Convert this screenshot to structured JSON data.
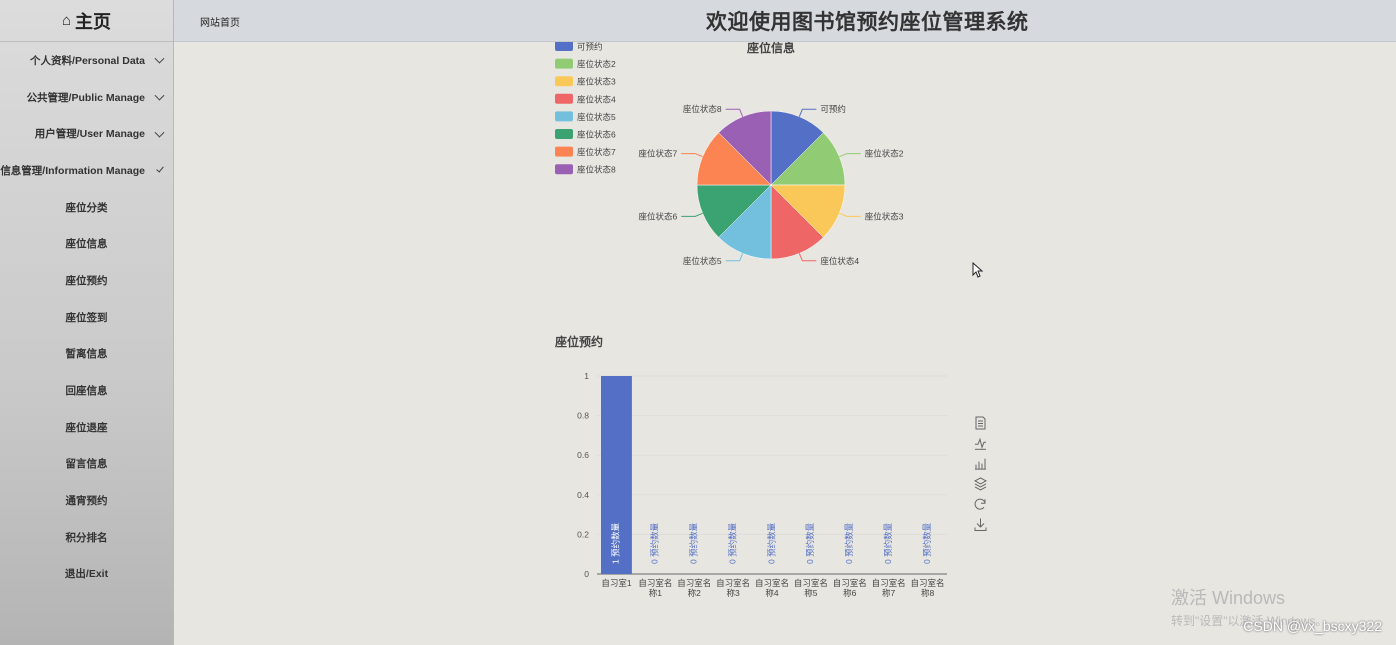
{
  "sidebar": {
    "brand": "主页",
    "items": [
      {
        "label": "个人资料/Personal Data",
        "type": "group"
      },
      {
        "label": "公共管理/Public Manage",
        "type": "group"
      },
      {
        "label": "用户管理/User Manage",
        "type": "group"
      },
      {
        "label": "信息管理/Information Manage",
        "type": "group-open"
      },
      {
        "label": "座位分类",
        "type": "sub"
      },
      {
        "label": "座位信息",
        "type": "sub"
      },
      {
        "label": "座位预约",
        "type": "sub"
      },
      {
        "label": "座位签到",
        "type": "sub"
      },
      {
        "label": "暂离信息",
        "type": "sub"
      },
      {
        "label": "回座信息",
        "type": "sub"
      },
      {
        "label": "座位退座",
        "type": "sub"
      },
      {
        "label": "留言信息",
        "type": "sub"
      },
      {
        "label": "通宵预约",
        "type": "sub"
      },
      {
        "label": "积分排名",
        "type": "sub"
      },
      {
        "label": "退出/Exit",
        "type": "sub"
      }
    ]
  },
  "header": {
    "breadcrumb": "网站首页",
    "title": "欢迎使用图书馆预约座位管理系统"
  },
  "toolbox": {
    "icons": [
      "data-view-icon",
      "line-chart-icon",
      "bar-chart-icon",
      "stack-icon",
      "restore-icon",
      "save-image-icon"
    ]
  },
  "watermark": {
    "line1": "激活 Windows",
    "line2": "转到\"设置\"以激活 Windows。",
    "credit": "CSDN @vx_bscxy322"
  },
  "chart_data": [
    {
      "type": "pie",
      "title": "座位信息",
      "categories": [
        "可预约",
        "座位状态2",
        "座位状态3",
        "座位状态4",
        "座位状态5",
        "座位状态6",
        "座位状态7",
        "座位状态8"
      ],
      "values": [
        1,
        1,
        1,
        1,
        1,
        1,
        1,
        1
      ],
      "colors": [
        "#5470c6",
        "#91cc75",
        "#fac858",
        "#ee6666",
        "#73c0de",
        "#3ba272",
        "#fc8452",
        "#9a60b4"
      ],
      "legend": "top-left"
    },
    {
      "type": "bar",
      "title": "座位预约",
      "categories": [
        "自习室1",
        "自习室名称1",
        "自习室名称2",
        "自习室名称3",
        "自习室名称4",
        "自习室名称5",
        "自习室名称6",
        "自习室名称7",
        "自习室名称8"
      ],
      "values": [
        1,
        0,
        0,
        0,
        0,
        0,
        0,
        0,
        0
      ],
      "data_label": "预约数量",
      "ylim": [
        0,
        1
      ],
      "yticks": [
        "0",
        "0.2",
        "0.4",
        "0.6",
        "0.8",
        "1"
      ],
      "bar_color": "#5470c6"
    }
  ]
}
